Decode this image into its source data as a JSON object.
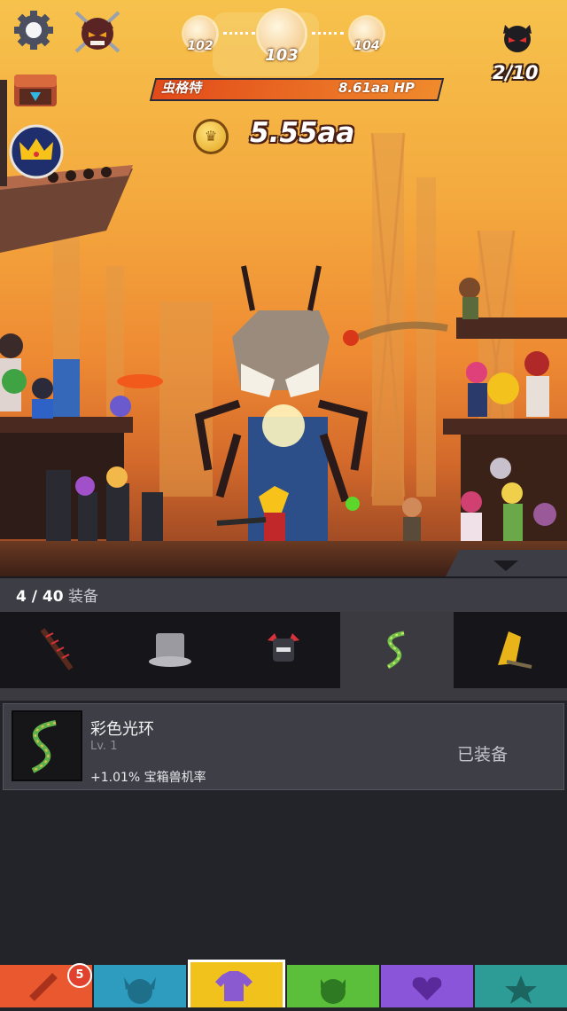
{
  "hud": {
    "stages": [
      {
        "num": "102",
        "state": "cleared"
      },
      {
        "num": "103",
        "state": "current"
      },
      {
        "num": "104",
        "state": "next"
      }
    ],
    "kill_progress": "2/10",
    "boss": {
      "name": "虫格特",
      "hp": "8.61aa HP"
    },
    "gold": "5.55aa"
  },
  "equipment": {
    "slot_count": "4 / 40",
    "slot_label": "装备",
    "tabs": [
      {
        "icon": "spiked-bat-icon",
        "selected": false
      },
      {
        "icon": "top-hat-icon",
        "selected": false
      },
      {
        "icon": "horned-helmet-icon",
        "selected": false
      },
      {
        "icon": "rainbow-aura-icon",
        "selected": true
      },
      {
        "icon": "golden-wing-sword-icon",
        "selected": false
      }
    ],
    "selected_item": {
      "name": "彩色光环",
      "level": "Lv. 1",
      "bonus": "+1.01% 宝箱兽机率",
      "status": "已装备"
    }
  },
  "bottom_nav": [
    {
      "icon": "sword-icon",
      "color": "#e9582e",
      "badge": "5"
    },
    {
      "icon": "viking-helmet-icon",
      "color": "#2e9cbf"
    },
    {
      "icon": "shirt-icon",
      "color": "#f2c21c",
      "active": true
    },
    {
      "icon": "monster-icon",
      "color": "#5bbf3b"
    },
    {
      "icon": "heart-icon",
      "color": "#8a55d8"
    },
    {
      "icon": "star-icon",
      "color": "#2d9c96"
    }
  ]
}
